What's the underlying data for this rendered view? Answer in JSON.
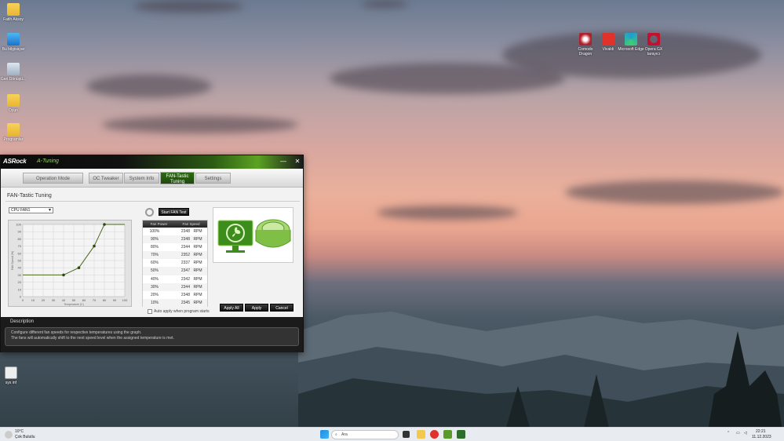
{
  "desktop": {
    "icons_left": [
      {
        "label": "Fatih Aksoy",
        "icon": "folder-icon"
      },
      {
        "label": "Bu bilgisayar",
        "icon": "pc-icon"
      },
      {
        "label": "Geri Dönüşü...",
        "icon": "recycle-bin-icon"
      },
      {
        "label": "Oyun",
        "icon": "folder-icon"
      },
      {
        "label": "Programlar",
        "icon": "folder-icon"
      },
      {
        "label": "sys inf",
        "icon": "app-icon"
      }
    ],
    "icons_right": [
      {
        "label": "Comodo Dragon",
        "color": "#b0202a"
      },
      {
        "label": "Vivaldi",
        "color": "#e0312b"
      },
      {
        "label": "Microsoft Edge",
        "color": "#1d9bd7"
      },
      {
        "label": "Opera GX tarayıcı",
        "color": "#c3102f"
      }
    ]
  },
  "window": {
    "brand": "ASRock",
    "title": "A-Tuning",
    "minimize": "—",
    "close": "✕",
    "tabs": [
      {
        "label": "Operation Mode"
      },
      {
        "label": "OC Tweaker"
      },
      {
        "label": "System Info"
      },
      {
        "label": "FAN-Tastic Tuning",
        "line1": "FAN-Tastic",
        "line2": "Tuning",
        "active": true
      },
      {
        "label": "Settings"
      }
    ],
    "section_title": "FAN-Tastic Tuning",
    "fan_select": "CPU FAN1",
    "start_test": "Start FAN Test",
    "table_headers": [
      "Fan Power",
      "Fan Speed"
    ],
    "table_rows": [
      {
        "power": "100%",
        "speed": "2348",
        "unit": "RPM"
      },
      {
        "power": "90%",
        "speed": "2348",
        "unit": "RPM"
      },
      {
        "power": "80%",
        "speed": "2344",
        "unit": "RPM"
      },
      {
        "power": "70%",
        "speed": "2352",
        "unit": "RPM"
      },
      {
        "power": "60%",
        "speed": "2337",
        "unit": "RPM"
      },
      {
        "power": "50%",
        "speed": "2347",
        "unit": "RPM"
      },
      {
        "power": "40%",
        "speed": "2342",
        "unit": "RPM"
      },
      {
        "power": "30%",
        "speed": "2344",
        "unit": "RPM"
      },
      {
        "power": "20%",
        "speed": "2348",
        "unit": "RPM"
      },
      {
        "power": "10%",
        "speed": "2345",
        "unit": "RPM"
      }
    ],
    "auto_apply": "Auto apply when program starts",
    "buttons": {
      "apply_all": "Apply All",
      "apply": "Apply",
      "cancel": "Cancel"
    },
    "description_title": "Description",
    "description_line1": "Configure different fan speeds for respective temperatures using the graph.",
    "description_line2": "The fans will automatically shift to the next speed level when the assigned temperature is met."
  },
  "chart_data": {
    "type": "line",
    "xlabel": "Temperature (C)",
    "ylabel": "FAN Speed (%)",
    "xlim": [
      0,
      100
    ],
    "ylim": [
      0,
      100
    ],
    "xticks": [
      0,
      10,
      20,
      30,
      40,
      50,
      60,
      70,
      80,
      90,
      100
    ],
    "yticks": [
      0,
      10,
      20,
      30,
      40,
      50,
      60,
      70,
      80,
      90,
      100
    ],
    "grid": true,
    "series": [
      {
        "x": [
          0,
          40,
          55,
          70,
          80,
          100
        ],
        "y": [
          30,
          30,
          40,
          70,
          100,
          100
        ]
      }
    ],
    "points": [
      {
        "x": 40,
        "y": 30
      },
      {
        "x": 55,
        "y": 40
      },
      {
        "x": 70,
        "y": 70
      },
      {
        "x": 80,
        "y": 100
      }
    ]
  },
  "taskbar": {
    "weather_temp": "10°C",
    "weather_text": "Çok Bulutlu",
    "search_placeholder": "Ara",
    "time": "22:21",
    "date": "11.12.2023"
  }
}
